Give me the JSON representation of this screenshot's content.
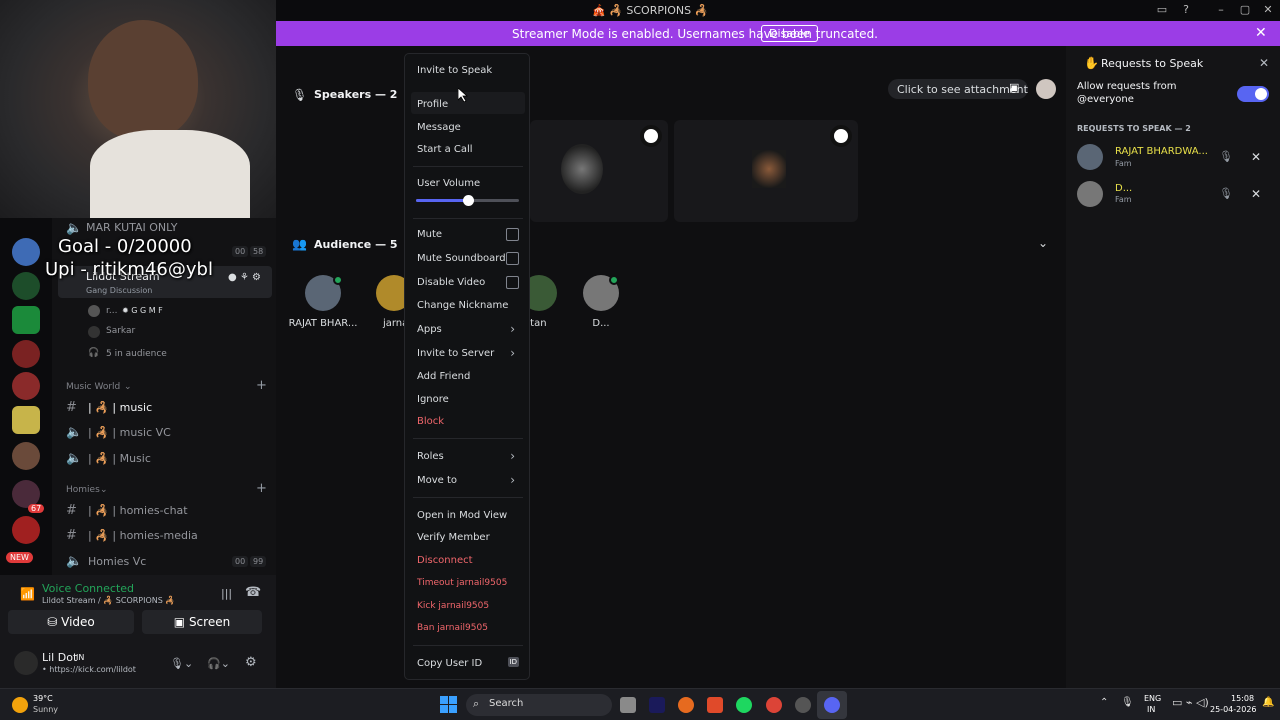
{
  "window": {
    "title": "🎪 🦂 SCORPIONS 🦂"
  },
  "banner": {
    "text": "Streamer Mode is enabled. Usernames have been truncated.",
    "button": "Disable"
  },
  "overlay": {
    "goal": "Goal - 0/20000",
    "upi": "Upi - ritikm46@ybl"
  },
  "sidebar": {
    "top_channel": "MAR KUTAI ONLY",
    "stream_channel": "Lildot Stream",
    "stream_sub": "Gang Discussion",
    "stream_count_a": "00",
    "stream_count_b": "58",
    "member1": "r...",
    "member1_tag": "✹ G G M F",
    "member2": "Sarkar",
    "audience": "5 in audience",
    "cat_music": "Music World",
    "music_chat": "| 🦂 | music",
    "music_vc": "| 🦂 | music VC",
    "music_stage": "| 🦂 | Music",
    "cat_homies": "Homies",
    "homies_chat": "| 🦂 | homies-chat",
    "homies_media": "| 🦂 | homies-media",
    "homies_vc": "Homies Vc",
    "homies_count_a": "00",
    "homies_count_b": "99"
  },
  "rail": {
    "badge": "67",
    "new": "NEW"
  },
  "voice": {
    "status": "Voice Connected",
    "location": "Lildot Stream / 🦂 SCORPIONS 🦂",
    "video": "Video",
    "screen": "Screen"
  },
  "user": {
    "name": "Lil Dot",
    "tag": "IN",
    "status": "• https://kick.com/lildot"
  },
  "stage": {
    "speakers": "Speakers — 2",
    "attachment": "Click to see attachment",
    "audience_label": "Audience — 5",
    "audience": [
      {
        "name": "RAJAT BHAR...",
        "color": "#5a6675"
      },
      {
        "name": "jarnai",
        "color": "#b08a2a"
      },
      {
        "name": "ltan",
        "color": "#3a5a36"
      },
      {
        "name": "D...",
        "color": "#777777"
      }
    ]
  },
  "rpanel": {
    "title": "Requests to Speak",
    "allow": "Allow requests from @everyone",
    "section": "REQUESTS TO SPEAK — 2",
    "requests": [
      {
        "name": "RAJAT BHARDWA...",
        "role": "Fam"
      },
      {
        "name": "D...",
        "role": "Fam"
      }
    ]
  },
  "menu": {
    "invite_speak": "Invite to Speak",
    "profile": "Profile",
    "message": "Message",
    "call": "Start a Call",
    "volume": "User Volume",
    "volume_level": 0.5,
    "mute": "Mute",
    "mute_sb": "Mute Soundboard",
    "disable_video": "Disable Video",
    "nickname": "Change Nickname",
    "apps": "Apps",
    "invite_server": "Invite to Server",
    "add_friend": "Add Friend",
    "ignore": "Ignore",
    "block": "Block",
    "roles": "Roles",
    "move": "Move to",
    "mod_view": "Open in Mod View",
    "verify": "Verify Member",
    "disconnect": "Disconnect",
    "timeout": "Timeout jarnail9505",
    "kick": "Kick jarnail9505",
    "ban": "Ban jarnail9505",
    "copy_id": "Copy User ID",
    "id_badge": "ID"
  },
  "taskbar": {
    "temp": "39°C",
    "weather": "Sunny",
    "search": "Search",
    "lang": "ENG",
    "region": "IN",
    "time": "15:08",
    "date": "25-04-2026"
  },
  "colors": {
    "accent": "#5865f2",
    "banner": "#9b3de6",
    "danger": "#f0666b",
    "online": "#23a55a",
    "request_name": "#e8e04a"
  }
}
